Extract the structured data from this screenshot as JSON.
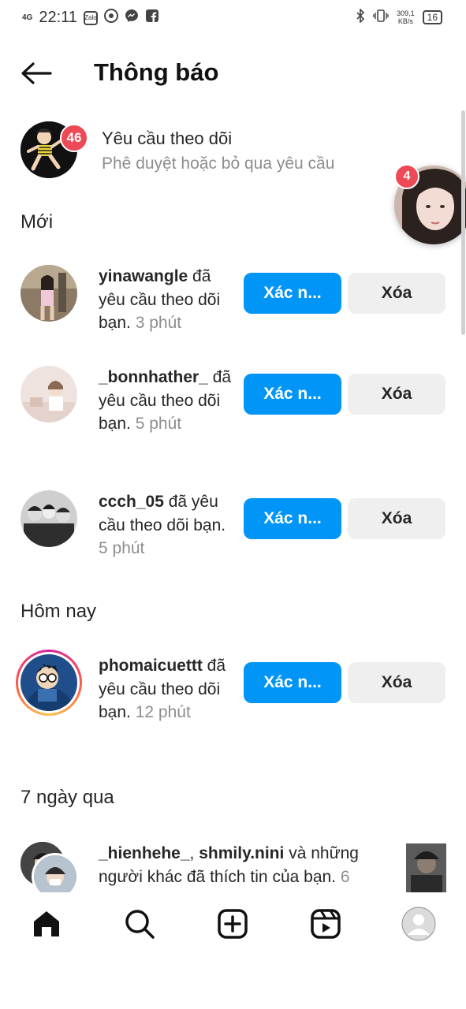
{
  "status_bar": {
    "network": "4G",
    "time": "22:11",
    "app_icons": [
      "zalo-icon",
      "chrome-icon",
      "messenger-icon",
      "facebook-icon"
    ],
    "zalo_label": "Zalo",
    "speed_value": "309,1",
    "speed_unit": "KB/s",
    "battery": "16"
  },
  "header": {
    "title": "Thông báo",
    "back_icon": "arrow-left-icon"
  },
  "follow_requests": {
    "badge": "46",
    "title": "Yêu cầu theo dõi",
    "subtitle": "Phê duyệt hoặc bỏ qua yêu cầu"
  },
  "floating_chat_head": {
    "badge": "4"
  },
  "sections": {
    "new": "Mới",
    "today": "Hôm nay",
    "last7": "7 ngày qua"
  },
  "requests": [
    {
      "username": "yinawangle",
      "action": " đã yêu cầu theo dõi bạn. ",
      "time": "3 phút",
      "confirm": "Xác n...",
      "delete": "Xóa"
    },
    {
      "username": "_bonnhather_",
      "action": " đã yêu cầu theo dõi bạn. ",
      "time": "5 phút",
      "confirm": "Xác n...",
      "delete": "Xóa"
    },
    {
      "username": "ccch_05",
      "action": " đã yêu cầu theo dõi bạn. ",
      "time": "5 phút",
      "confirm": "Xác n...",
      "delete": "Xóa"
    },
    {
      "username": "phomaicuettt",
      "action": " đã yêu cầu theo dõi bạn. ",
      "time": "12 phút",
      "confirm": "Xác n...",
      "delete": "Xóa"
    }
  ],
  "activity": {
    "user1": "_hienhehe_",
    "sep": ", ",
    "user2": "shmily.nini",
    "text": " và những người khác đã thích tin của bạn. ",
    "time": "6"
  },
  "bottom_nav": [
    "home-icon",
    "search-icon",
    "new-post-icon",
    "reels-icon",
    "profile-icon"
  ],
  "colors": {
    "primary_button": "#0095f6",
    "secondary_button": "#efefef",
    "badge": "#ed4956",
    "muted_text": "#8e8e8e"
  }
}
